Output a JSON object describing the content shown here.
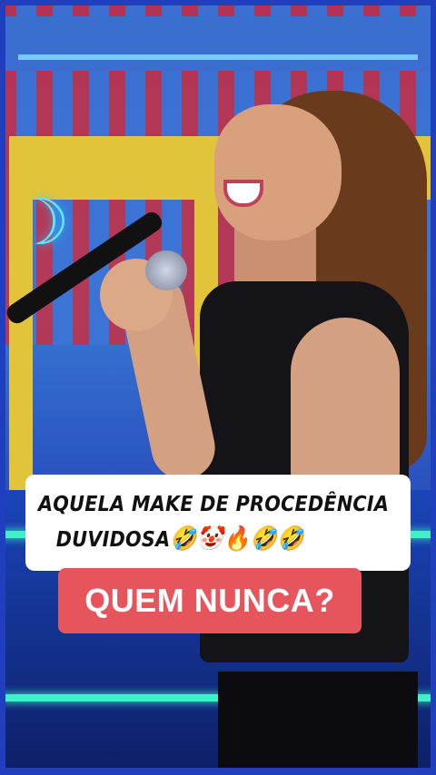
{
  "caption": {
    "line1": "AQUELA MAKE DE PROCEDÊNCIA",
    "line2": "DUVIDOSA",
    "emojis": "🤣🤡🔥🤣🤣"
  },
  "badge": {
    "text": "QUEM NUNCA?"
  },
  "colors": {
    "badge_bg": "#e7555c",
    "frame_border": "#1f3fbf",
    "caption_bg": "#ffffff"
  }
}
